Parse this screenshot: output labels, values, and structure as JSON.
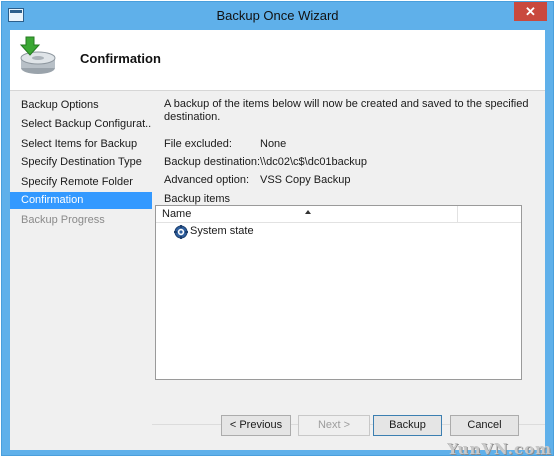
{
  "window": {
    "title": "Backup Once Wizard",
    "close_glyph": "✕"
  },
  "header": {
    "title": "Confirmation",
    "icon": "backup-drive-icon"
  },
  "nav": {
    "items": [
      {
        "label": "Backup Options",
        "state": "normal"
      },
      {
        "label": "Select Backup Configurat...",
        "state": "normal"
      },
      {
        "label": "Select Items for Backup",
        "state": "normal"
      },
      {
        "label": "Specify Destination Type",
        "state": "normal"
      },
      {
        "label": "Specify Remote Folder",
        "state": "normal"
      },
      {
        "label": "Confirmation",
        "state": "active"
      },
      {
        "label": "Backup Progress",
        "state": "disabled"
      }
    ]
  },
  "content": {
    "intro": "A backup of the items below will now be created and saved to the specified destination.",
    "file_excluded_label": "File excluded:",
    "file_excluded_value": "None",
    "destination_label": "Backup destination:",
    "destination_value": "\\\\dc02\\c$\\dc01backup",
    "advanced_label": "Advanced option:",
    "advanced_value": "VSS Copy Backup",
    "items_caption": "Backup items"
  },
  "listview": {
    "column_name": "Name",
    "rows": [
      {
        "label": "System state",
        "icon": "system-state-gear-icon"
      }
    ]
  },
  "buttons": {
    "previous": "< Previous",
    "next": "Next >",
    "backup": "Backup",
    "cancel": "Cancel"
  },
  "watermark": "YunVN.com",
  "colors": {
    "titlebar": "#5fb0ea",
    "selection": "#3399ff",
    "close": "#c9493e"
  }
}
